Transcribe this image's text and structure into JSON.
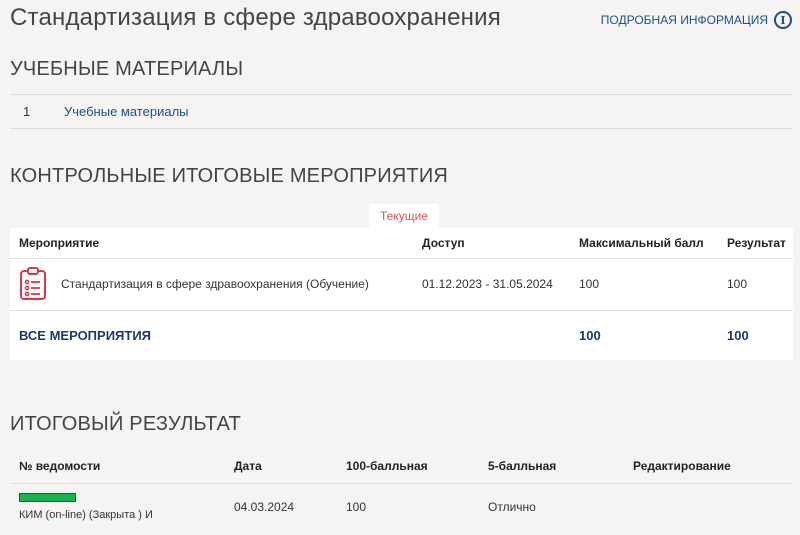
{
  "header": {
    "title": "Стандартизация в сфере здравоохранения",
    "more_info": "ПОДРОБНАЯ ИНФОРМАЦИЯ",
    "info_glyph": "i",
    "info_icon": "info-circle-icon"
  },
  "materials": {
    "section_title": "УЧЕБНЫЕ МАТЕРИАЛЫ",
    "items": [
      {
        "num": "1",
        "label": "Учебные материалы"
      }
    ]
  },
  "events": {
    "section_title": "КОНТРОЛЬНЫЕ ИТОГОВЫЕ МЕРОПРИЯТИЯ",
    "tab_current": "Текущие",
    "columns": [
      "Мероприятие",
      "Доступ",
      "Максимальный балл",
      "Результат"
    ],
    "rows": [
      {
        "name": "Стандартизация в сфере здравоохранения (Обучение)",
        "access": "01.12.2023 - 31.05.2024",
        "max": "100",
        "result": "100",
        "icon": "clipboard-icon"
      }
    ],
    "total": {
      "label": "ВСЕ МЕРОПРИЯТИЯ",
      "max": "100",
      "result": "100"
    },
    "accent_color": "#d9534f"
  },
  "results": {
    "section_title": "ИТОГОВЫЙ РЕЗУЛЬТАТ",
    "columns": [
      "№ ведомости",
      "Дата",
      "100-балльная",
      "5-балльная",
      "Редактирование"
    ],
    "rows": [
      {
        "ved_sub": "КИМ (on-line) (Закрыта ) И",
        "date": "04.03.2024",
        "score100": "100",
        "score5": "Отлично",
        "edit": ""
      }
    ],
    "bar_color": "#19b24b"
  }
}
